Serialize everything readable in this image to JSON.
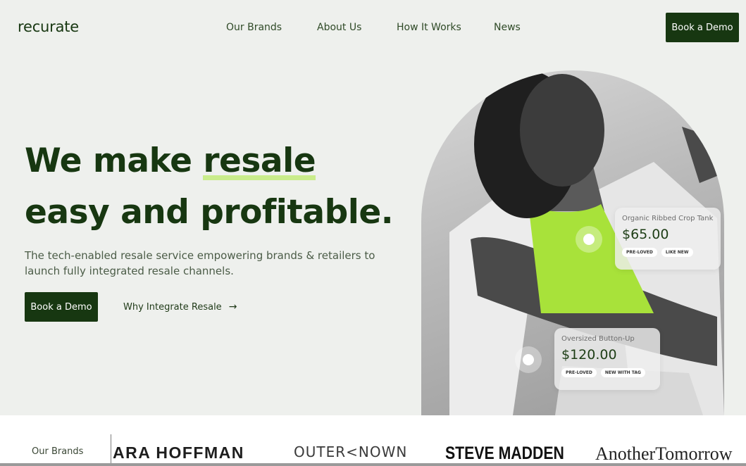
{
  "header": {
    "logo": "recurate",
    "nav": [
      "Our Brands",
      "About Us",
      "How It Works",
      "News"
    ],
    "cta": "Book a Demo"
  },
  "hero": {
    "headline_before": "We make ",
    "headline_highlight": "resale",
    "headline_line2": "easy and profitable.",
    "subtext": "The tech-enabled resale service empowering brands & retailers to launch fully integrated resale channels.",
    "cta": "Book a Demo",
    "secondary_link": "Why Integrate Resale",
    "arrow": "→"
  },
  "products": [
    {
      "title": "Organic Ribbed Crop Tank",
      "price": "$65.00",
      "tags": [
        "PRE-LOVED",
        "LIKE NEW"
      ]
    },
    {
      "title": "Oversized Button-Up",
      "price": "$120.00",
      "tags": [
        "PRE-LOVED",
        "NEW WITH TAG"
      ]
    }
  ],
  "brands": {
    "label": "Our Brands",
    "items": [
      "ARA HOFFMAN",
      "OUTER<NOWN",
      "STEVE MADDEN",
      "AnotherTomorrow"
    ]
  },
  "colors": {
    "brand_green": "#173711",
    "accent_lime": "#c9ec8b",
    "background": "#eef0ed"
  }
}
